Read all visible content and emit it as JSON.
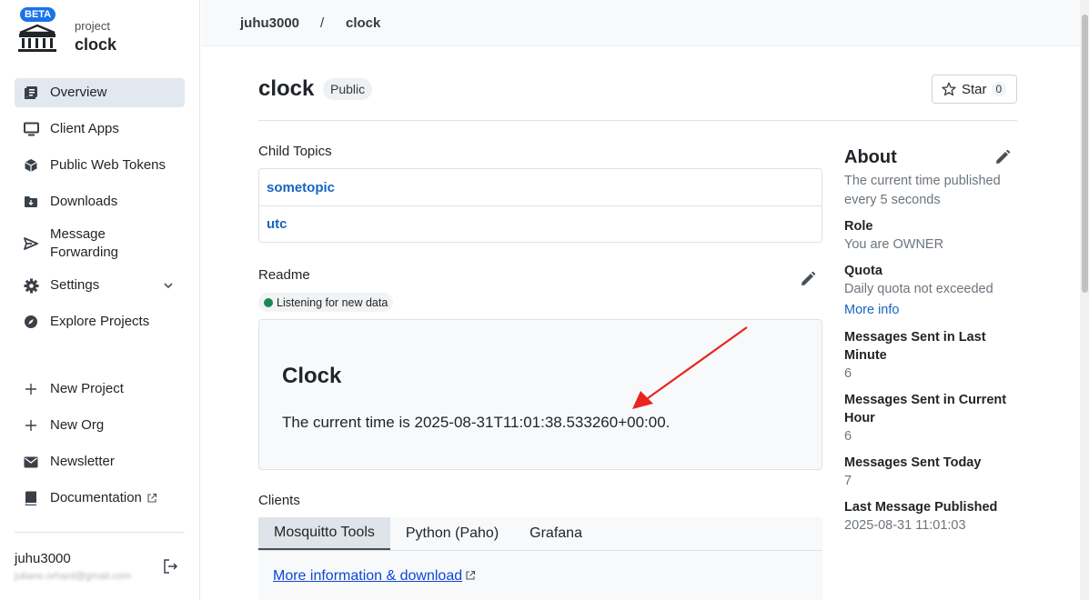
{
  "brand": {
    "beta": "BETA",
    "subtitle": "project",
    "name": "clock"
  },
  "sidebar": {
    "items": [
      {
        "label": "Overview",
        "icon": "overview-icon"
      },
      {
        "label": "Client Apps",
        "icon": "monitor-icon"
      },
      {
        "label": "Public Web Tokens",
        "icon": "cube-icon"
      },
      {
        "label": "Downloads",
        "icon": "folder-download-icon"
      },
      {
        "label": "Message Forwarding",
        "icon": "send-icon"
      },
      {
        "label": "Settings",
        "icon": "gear-icon"
      },
      {
        "label": "Explore Projects",
        "icon": "compass-icon"
      }
    ],
    "secondary": [
      {
        "label": "New Project",
        "icon": "plus-icon"
      },
      {
        "label": "New Org",
        "icon": "plus-icon"
      },
      {
        "label": "Newsletter",
        "icon": "mail-icon"
      },
      {
        "label": "Documentation",
        "icon": "book-icon"
      }
    ],
    "user": {
      "name": "juhu3000",
      "email": "juliano.orhard@gmail.com"
    }
  },
  "breadcrumb": {
    "org": "juhu3000",
    "sep": "/",
    "project": "clock"
  },
  "header": {
    "title": "clock",
    "visibility": "Public",
    "star_label": "Star",
    "star_count": "0"
  },
  "child_topics": {
    "label": "Child Topics",
    "items": [
      "sometopic",
      "utc"
    ]
  },
  "readme": {
    "label": "Readme",
    "status": "Listening for new data",
    "heading": "Clock",
    "body": "The current time is 2025-08-31T11:01:38.533260+00:00."
  },
  "clients": {
    "label": "Clients",
    "tabs": [
      "Mosquitto Tools",
      "Python (Paho)",
      "Grafana"
    ],
    "link": "More information & download"
  },
  "about": {
    "title": "About",
    "description": "The current time published every 5 seconds",
    "role_label": "Role",
    "role_value": "You are OWNER",
    "quota_label": "Quota",
    "quota_value": "Daily quota not exceeded",
    "more_info": "More info",
    "last_minute_label": "Messages Sent in Last Minute",
    "last_minute_value": "6",
    "current_hour_label": "Messages Sent in Current Hour",
    "current_hour_value": "6",
    "today_label": "Messages Sent Today",
    "today_value": "7",
    "last_published_label": "Last Message Published",
    "last_published_value": "2025-08-31 11:01:03"
  },
  "colors": {
    "accent": "#1565c0",
    "active_nav": "#e2e8ef",
    "status_green": "#198754",
    "annotation_arrow": "#e8251f"
  }
}
